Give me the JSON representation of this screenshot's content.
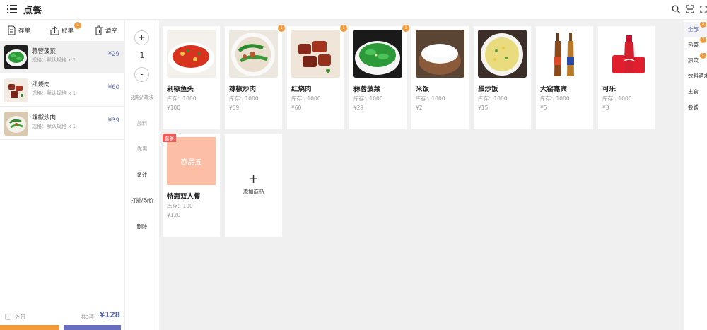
{
  "header": {
    "title": "点餐"
  },
  "cart": {
    "toolbar": {
      "save": "存单",
      "take": "取单",
      "take_badge": "1",
      "clear": "清空"
    },
    "items": [
      {
        "name": "蒜蓉菠菜",
        "spec": "规格：默认规格 x 1",
        "price": "¥29",
        "selected": true
      },
      {
        "name": "红烧肉",
        "spec": "规格：默认规格 x 1",
        "price": "¥60"
      },
      {
        "name": "辣椒炒肉",
        "spec": "规格：默认规格 x 1",
        "price": "¥39"
      }
    ],
    "takeout_label": "外带",
    "total_label": "共3项",
    "total_value": "¥128"
  },
  "ops": {
    "plus": "+",
    "qty": "1",
    "minus": "-",
    "spec_method": "规格/做法",
    "add_on": "加料",
    "discount": "优惠",
    "remark": "备注",
    "rebate": "打折/改价",
    "delete": "删除"
  },
  "products": [
    {
      "name": "剁椒鱼头",
      "stock": "库存：1000",
      "price": "¥100",
      "badge": ""
    },
    {
      "name": "辣椒炒肉",
      "stock": "库存：1000",
      "price": "¥39",
      "badge": "1"
    },
    {
      "name": "红烧肉",
      "stock": "库存：1000",
      "price": "¥60",
      "badge": "1"
    },
    {
      "name": "蒜蓉菠菜",
      "stock": "库存：1000",
      "price": "¥29",
      "badge": "1"
    },
    {
      "name": "米饭",
      "stock": "库存：1000",
      "price": "¥2",
      "badge": ""
    },
    {
      "name": "蛋炒饭",
      "stock": "库存：1000",
      "price": "¥15",
      "badge": ""
    },
    {
      "name": "大窑嘉宾",
      "stock": "库存：1000",
      "price": "¥5",
      "badge": ""
    },
    {
      "name": "可乐",
      "stock": "库存：1000",
      "price": "¥3",
      "badge": ""
    }
  ],
  "combo": {
    "tag": "套餐",
    "placeholder": "商品五",
    "name": "特惠双人餐",
    "stock": "库存：100",
    "price": "¥120"
  },
  "add_product": {
    "icon": "+",
    "label": "添加商品"
  },
  "categories": [
    {
      "label": "全部",
      "badge": "3",
      "active": true
    },
    {
      "label": "热菜",
      "badge": "2"
    },
    {
      "label": "凉菜",
      "badge": "1"
    },
    {
      "label": "饮料酒水",
      "badge": ""
    },
    {
      "label": "主食",
      "badge": ""
    },
    {
      "label": "套餐",
      "badge": ""
    }
  ],
  "colors": {
    "accent": "#5566aa",
    "orange": "#f39a3a",
    "tag_red": "#ee5a5a"
  }
}
